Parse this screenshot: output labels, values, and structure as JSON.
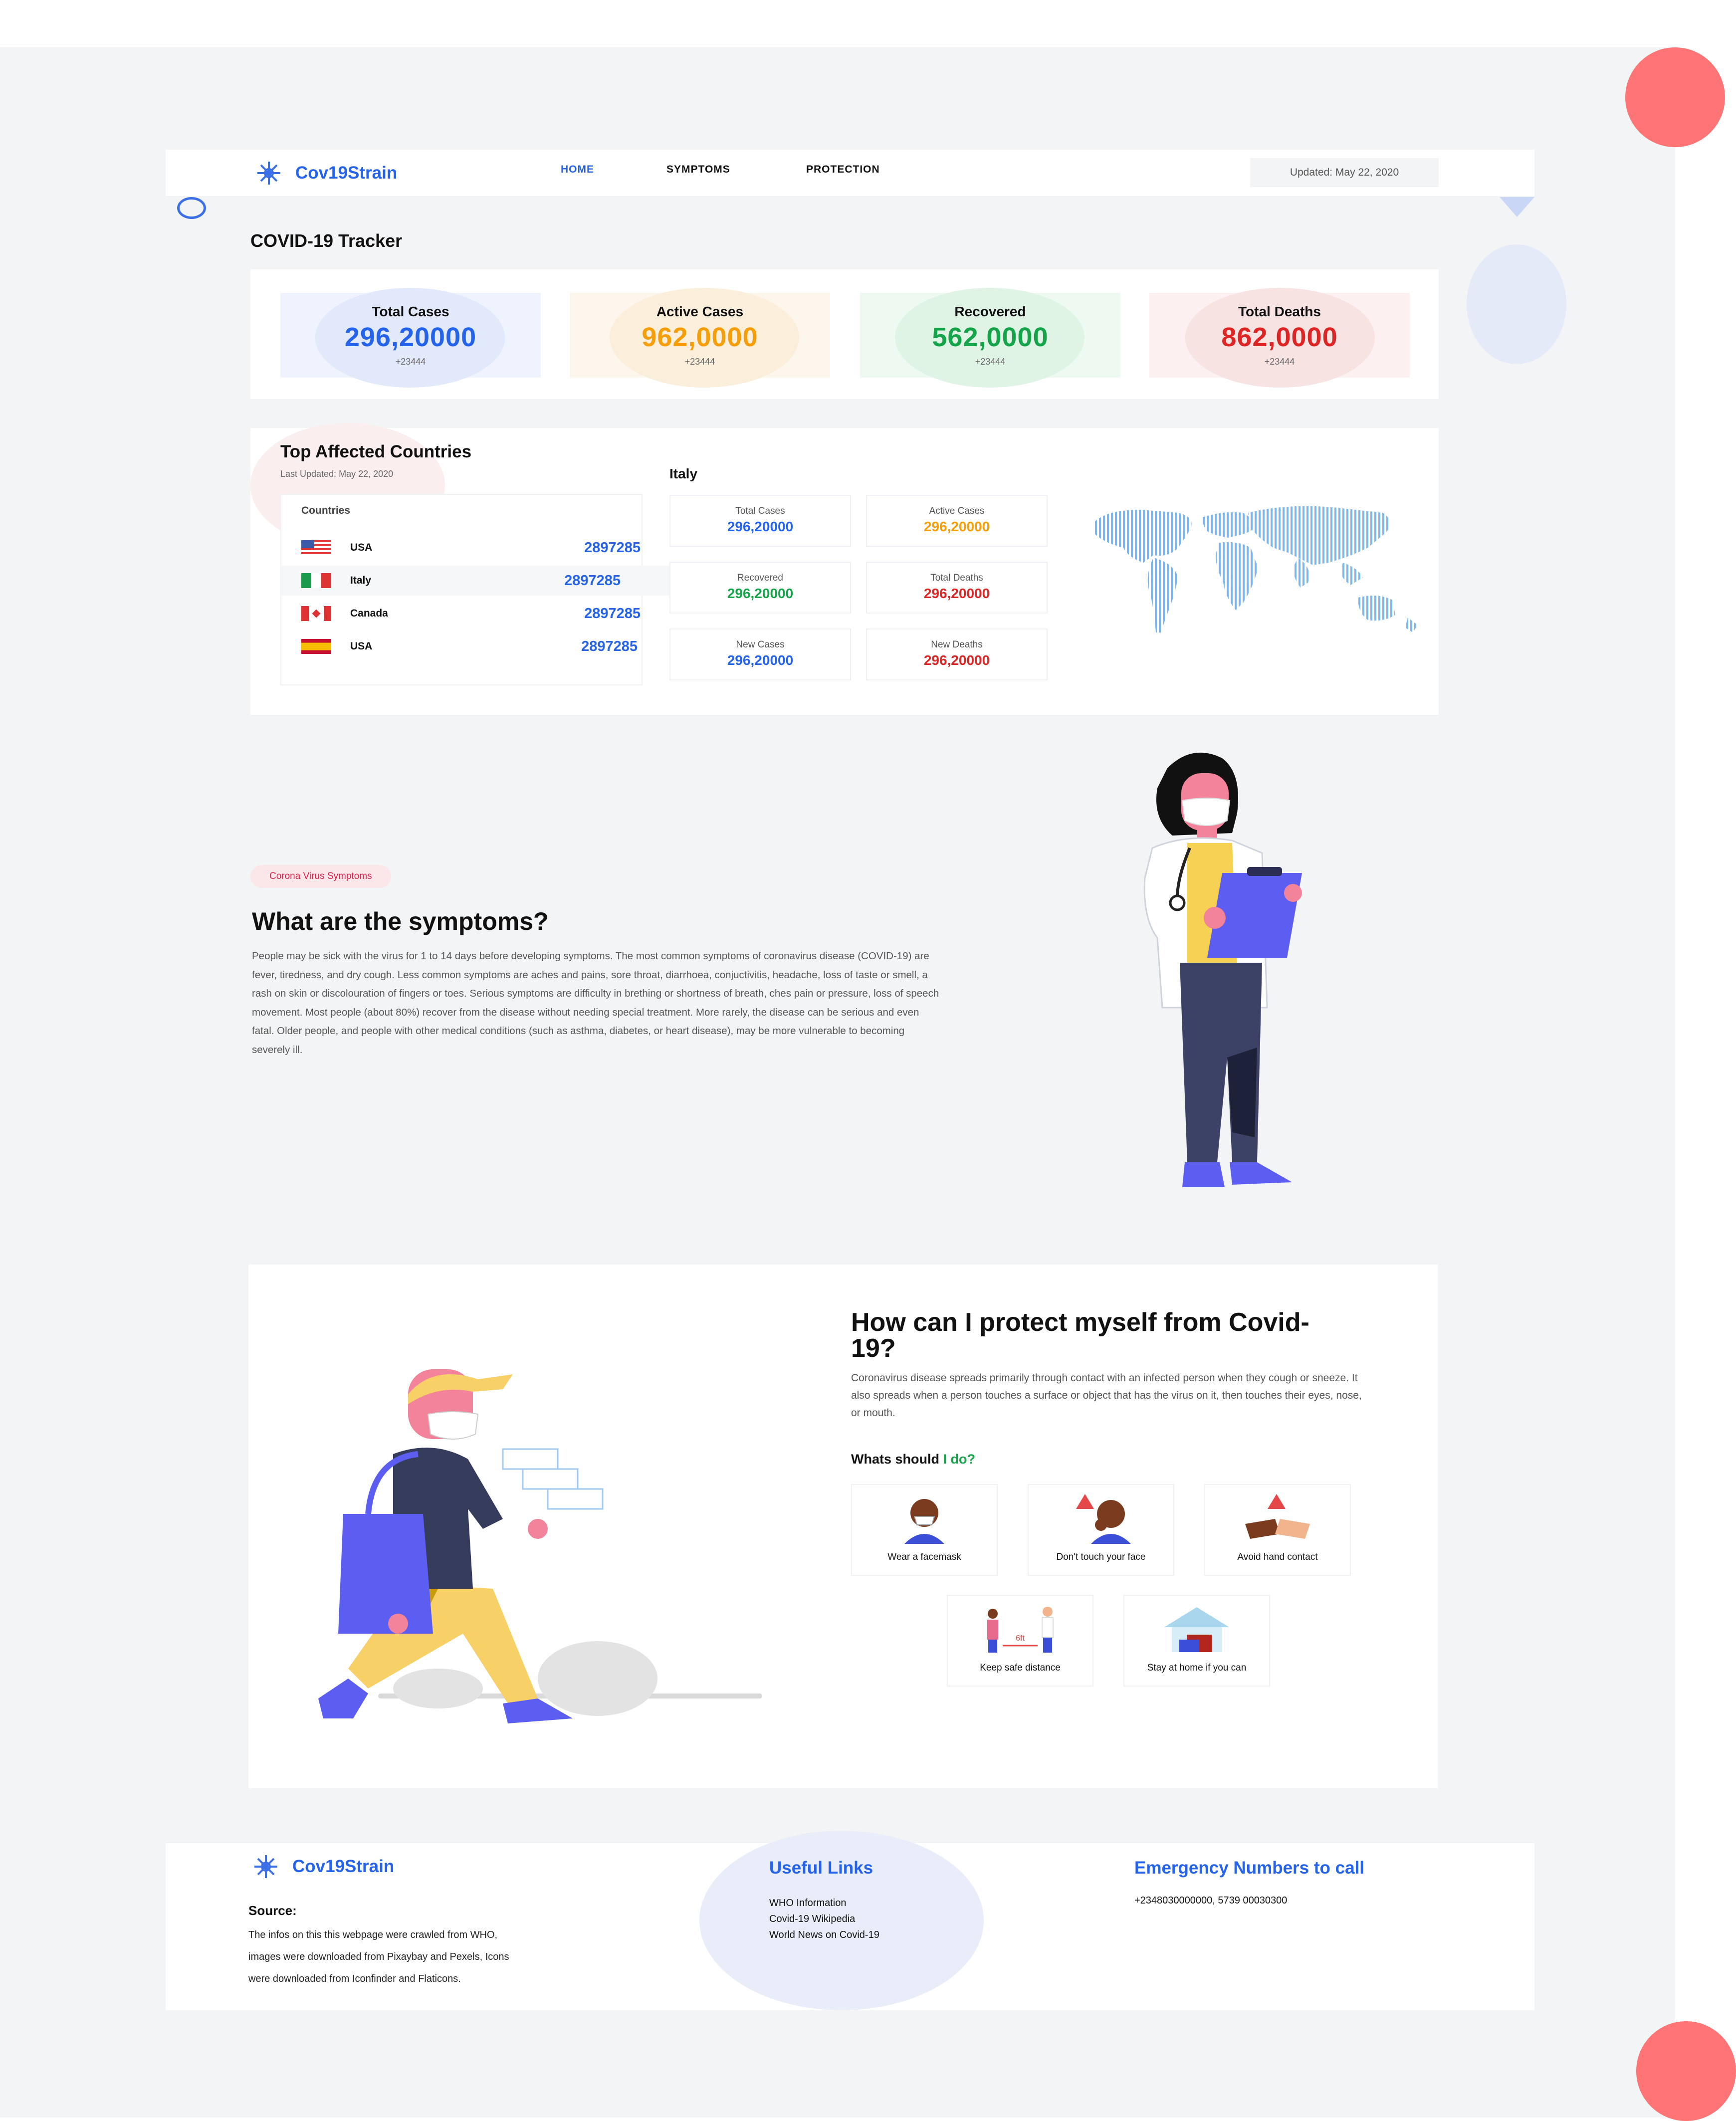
{
  "brand": {
    "name": "Cov19Strain"
  },
  "nav": {
    "links": [
      "HOME",
      "SYMPTOMS",
      "PROTECTION"
    ],
    "updated": "Updated: May 22, 2020"
  },
  "tracker": {
    "title": "COVID-19 Tracker",
    "stats": [
      {
        "label": "Total Cases",
        "value": "296,20000",
        "delta": "+23444",
        "color": "#2563eb"
      },
      {
        "label": "Active Cases",
        "value": "962,0000",
        "delta": "+23444",
        "color": "#f59e0b"
      },
      {
        "label": "Recovered",
        "value": "562,0000",
        "delta": "+23444",
        "color": "#16a34a"
      },
      {
        "label": "Total Deaths",
        "value": "862,0000",
        "delta": "+23444",
        "color": "#dc2626"
      }
    ]
  },
  "affected": {
    "title": "Top Affected Countries",
    "updated": "Last Updated: May 22, 2020",
    "list_header": "Countries",
    "countries": [
      {
        "name": "USA",
        "value": "2897285",
        "flag": "us-flag"
      },
      {
        "name": "Italy",
        "value": "2897285",
        "flag": "italy-flag"
      },
      {
        "name": "Canada",
        "value": "2897285",
        "flag": "canada-flag"
      },
      {
        "name": "USA",
        "value": "2897285",
        "flag": "spain-flag"
      }
    ],
    "selected_country": "Italy",
    "details": [
      {
        "label": "Total Cases",
        "value": "296,20000",
        "color": "#2563eb"
      },
      {
        "label": "Active Cases",
        "value": "296,20000",
        "color": "#f59e0b"
      },
      {
        "label": "Recovered",
        "value": "296,20000",
        "color": "#16a34a"
      },
      {
        "label": "Total Deaths",
        "value": "296,20000",
        "color": "#dc2626"
      },
      {
        "label": "New Cases",
        "value": "296,20000",
        "color": "#2563eb"
      },
      {
        "label": "New Deaths",
        "value": "296,20000",
        "color": "#dc2626"
      }
    ]
  },
  "symptoms": {
    "badge": "Corona Virus Symptoms",
    "title": "What are the symptoms?",
    "body": "People may be sick with the virus for 1 to 14 days before developing symptoms. The most common symptoms of coronavirus disease (COVID-19) are fever, tiredness, and dry cough. Less common symptoms are aches and pains, sore throat, diarrhoea, conjuctivitis, headache, loss of taste or smell, a rash on skin or discolouration of fingers or toes. Serious symptoms are difficulty in brething or shortness of breath, ches pain or pressure, loss of speech movement. Most people (about 80%) recover from the disease without needing special treatment. More rarely, the disease can be serious and even fatal. Older people, and people with other medical conditions (such as asthma, diabetes, or heart disease), may be more vulnerable to becoming severely ill."
  },
  "protect": {
    "title": "How can I protect myself from Covid-19?",
    "body": "Coronavirus disease spreads primarily through contact with an infected person when they cough or sneeze. It also spreads when a person touches a surface or object that has the virus on it, then touches their eyes, nose, or mouth.",
    "what_prefix": "Whats should",
    "what_suffix": "I do?",
    "tips": [
      {
        "label": "Wear a facemask",
        "icon": "facemask-icon"
      },
      {
        "label": "Don't touch your face",
        "icon": "no-touch-face-icon"
      },
      {
        "label": "Avoid hand contact",
        "icon": "handshake-warning-icon"
      },
      {
        "label": "Keep safe distance",
        "icon": "distance-icon"
      },
      {
        "label": "Stay at home if you can",
        "icon": "home-icon"
      }
    ],
    "distance_text": "6ft"
  },
  "footer": {
    "brand": "Cov19Strain",
    "source_title": "Source:",
    "source_lines": [
      "The infos on this this webpage were crawled from WHO,",
      "images were downloaded from Pixaybay and Pexels, Icons",
      "were downloaded from Iconfinder and Flaticons."
    ],
    "links_title": "Useful Links",
    "links": [
      "WHO Information",
      "Covid-19 Wikipedia",
      "World News on Covid-19"
    ],
    "emergency_title": "Emergency Numbers to call",
    "emergency_numbers": "+2348030000000, 5739 00030300"
  },
  "colors": {
    "accent": "#2563eb",
    "warning": "#f59e0b",
    "success": "#16a34a",
    "danger": "#dc2626",
    "coral": "#ff7575",
    "page_bg": "#f3f4f6"
  }
}
